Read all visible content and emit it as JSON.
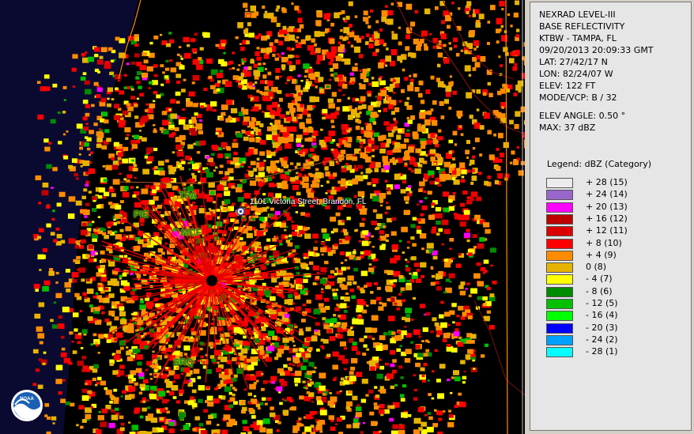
{
  "header": {
    "lines": [
      "NEXRAD LEVEL-III",
      "BASE REFLECTIVITY",
      "KTBW - TAMPA, FL",
      "09/20/2013 20:09:33 GMT",
      "LAT: 27/42/17 N",
      "LON: 82/24/07 W",
      "ELEV: 122 FT",
      "MODE/VCP: B / 32"
    ],
    "elev_angle": "ELEV ANGLE: 0.50 °",
    "max": "MAX: 37 dBZ"
  },
  "legend": {
    "title": "Legend: dBZ (Category)",
    "items": [
      {
        "label": "+ 28  (15)",
        "color": "#ececec"
      },
      {
        "label": "+ 24  (14)",
        "color": "#9966cc"
      },
      {
        "label": "+ 20  (13)",
        "color": "#ff00ff"
      },
      {
        "label": "+ 16  (12)",
        "color": "#bf0000"
      },
      {
        "label": "+ 12  (11)",
        "color": "#dc0000"
      },
      {
        "label": "+ 8  (10)",
        "color": "#ff0000"
      },
      {
        "label": "+ 4  (9)",
        "color": "#ff8c00"
      },
      {
        "label": "0  (8)",
        "color": "#e6b400"
      },
      {
        "label": "- 4  (7)",
        "color": "#ffff00"
      },
      {
        "label": "- 8  (6)",
        "color": "#008c00"
      },
      {
        "label": "- 12  (5)",
        "color": "#00c000"
      },
      {
        "label": "- 16  (4)",
        "color": "#00ff00"
      },
      {
        "label": "- 20  (3)",
        "color": "#0000ff"
      },
      {
        "label": "- 24  (2)",
        "color": "#00a0ff"
      },
      {
        "label": "- 28  (1)",
        "color": "#00ffff"
      }
    ]
  },
  "map": {
    "marker_label": "1101 Victoria Street, Brandon, FL",
    "cities": [
      "TPA",
      "PIE",
      "MCF",
      "SRQ"
    ],
    "logo_text": "NOAA"
  }
}
